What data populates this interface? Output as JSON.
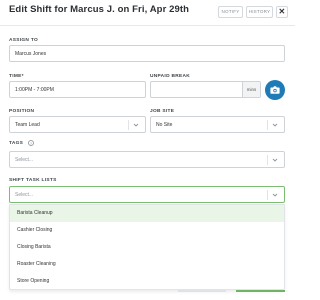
{
  "header": {
    "title": "Edit Shift for Marcus J. on Fri, Apr 29th",
    "notify_label": "NOTIFY",
    "history_label": "HISTORY",
    "close_glyph": "✕"
  },
  "form": {
    "assign_to": {
      "label": "ASSIGN TO",
      "value": "Marcus Jones"
    },
    "time": {
      "label": "TIME*",
      "value": "1:00PM - 7:00PM"
    },
    "unpaid_break": {
      "label": "UNPAID BREAK",
      "value": "",
      "suffix": "mins"
    },
    "position": {
      "label": "POSITION",
      "value": "Team Lead"
    },
    "job_site": {
      "label": "JOB SITE",
      "value": "No Site"
    },
    "tags": {
      "label": "TAGS",
      "placeholder": "Select...",
      "help": "?"
    },
    "shift_task_lists": {
      "label": "SHIFT TASK LISTS",
      "placeholder": "Select...",
      "options": [
        "Barista Cleanup",
        "Cashier Closing",
        "Closing Barista",
        "Roaster Cleaning",
        "Store Opening"
      ],
      "highlighted_index": 0
    }
  },
  "colors": {
    "accent_green": "#7cbd74",
    "highlight_bg": "#e9f5e6",
    "camera_button": "#1f7bb5"
  },
  "icons": {
    "camera": "camera-icon",
    "chevron": "chevron-down-icon",
    "help": "help-icon",
    "close": "close-icon"
  }
}
